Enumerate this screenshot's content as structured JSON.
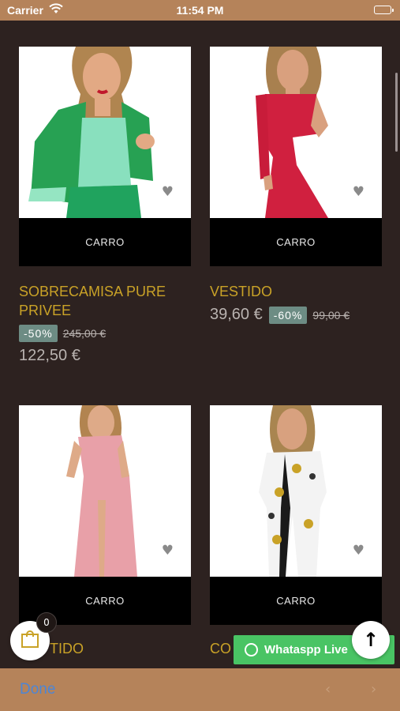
{
  "status_bar": {
    "carrier": "Carrier",
    "time": "11:54 PM"
  },
  "products": [
    {
      "name": "SOBRECAMISA PURE PRIVEE",
      "cart_label": "CARRO",
      "discount": "-50%",
      "old_price": "245,00 €",
      "price": "122,50 €"
    },
    {
      "name": "VESTIDO",
      "cart_label": "CARRO",
      "discount": "-60%",
      "old_price": "99,00 €",
      "price": "39,60 €"
    },
    {
      "name": "VESTIDO",
      "name_visible": "TIDO",
      "cart_label": "CARRO"
    },
    {
      "name_visible": "CO",
      "cart_label": "CARRO"
    }
  ],
  "bag": {
    "count": "0"
  },
  "whatsapp": {
    "label": "Whataspp Live"
  },
  "toolbar": {
    "done_label": "Done"
  },
  "colors": {
    "background": "#2d2220",
    "accent": "#c9a227",
    "badge": "#6d8c84",
    "bar": "#b5835a",
    "whatsapp": "#49c464"
  }
}
